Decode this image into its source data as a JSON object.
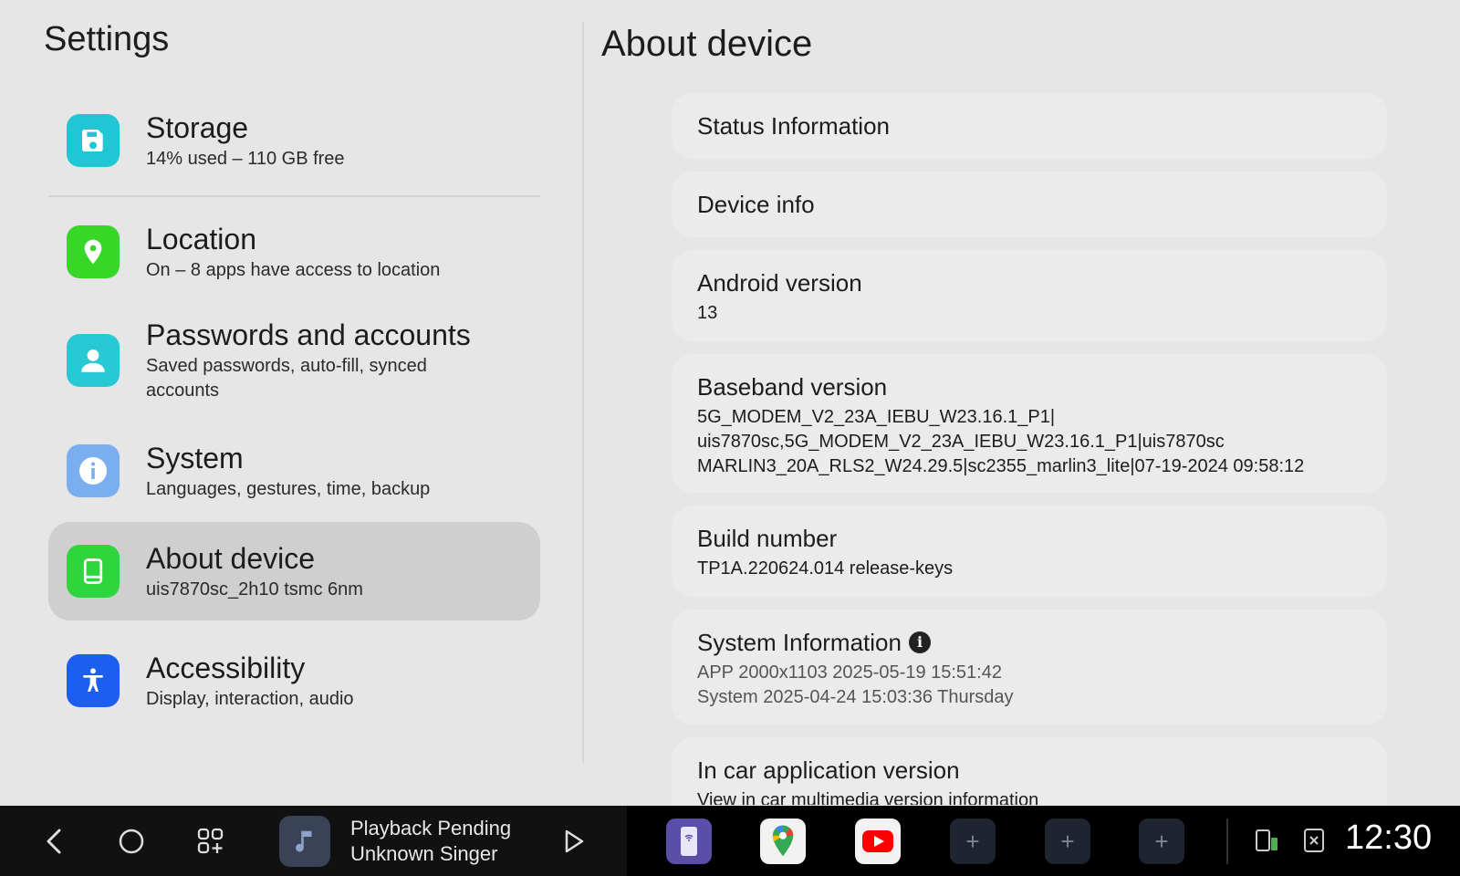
{
  "settings": {
    "title": "Settings",
    "items": [
      {
        "label": "Storage",
        "sub": "14% used – 110 GB free",
        "icon": "storage-icon",
        "color": "#1fc6d4"
      },
      {
        "label": "Location",
        "sub": "On – 8 apps have access to location",
        "icon": "location-pin-icon",
        "color": "#38d626"
      },
      {
        "label": "Passwords and accounts",
        "sub": "Saved passwords, auto-fill, synced accounts",
        "icon": "account-icon",
        "color": "#26c9d4"
      },
      {
        "label": "System",
        "sub": "Languages, gestures, time, backup",
        "icon": "info-icon",
        "color": "#79aef0"
      },
      {
        "label": "About device",
        "sub": "uis7870sc_2h10 tsmc 6nm",
        "icon": "device-icon",
        "color": "#2ed53c",
        "selected": true
      },
      {
        "label": "Accessibility",
        "sub": "Display, interaction, audio",
        "icon": "accessibility-icon",
        "color": "#1c5ff0"
      }
    ]
  },
  "about": {
    "title": "About device",
    "status": "Status Information",
    "device_info": "Device info",
    "android_label": "Android version",
    "android_value": "13",
    "baseband_label": "Baseband version",
    "baseband_lines": [
      "5G_MODEM_V2_23A_IEBU_W23.16.1_P1|",
      "uis7870sc,5G_MODEM_V2_23A_IEBU_W23.16.1_P1|uis7870sc",
      "MARLIN3_20A_RLS2_W24.29.5|sc2355_marlin3_lite|07-19-2024 09:58:12"
    ],
    "build_label": "Build number",
    "build_value": "TP1A.220624.014 release-keys",
    "sysinfo_label": "System Information",
    "sysinfo_lines": [
      "APP 2000x1103 2025-05-19 15:51:42",
      "System 2025-04-24 15:03:36 Thursday"
    ],
    "incar_label": "In car application version",
    "incar_value": "View in car multimedia version information"
  },
  "taskbar": {
    "media_title": "Playback Pending",
    "media_artist": "Unknown Singer",
    "clock": "12:30",
    "apps": [
      "wireless-app-icon",
      "maps-app-icon",
      "youtube-app-icon",
      "add-app-slot",
      "add-app-slot",
      "add-app-slot"
    ]
  }
}
